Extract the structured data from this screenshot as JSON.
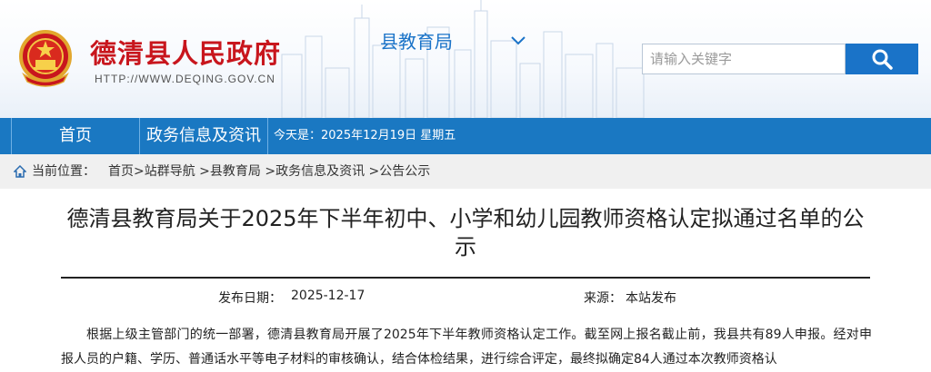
{
  "header": {
    "site_title": "德清县人民政府",
    "site_url": "HTTP://WWW.DEQING.GOV.CN",
    "dept_selector": "县教育局",
    "search_placeholder": "请输入关键字",
    "brand_red": "#c8161d",
    "brand_blue": "#1a73c8"
  },
  "nav": {
    "items": [
      {
        "label": "首页"
      },
      {
        "label": "政务信息及资讯"
      }
    ],
    "date_text": "今天是：2025年12月19日 星期五",
    "bg_color": "#1a78c2"
  },
  "breadcrumb": {
    "prefix": "当前位置：",
    "items": [
      {
        "label": "首页"
      },
      {
        "label": ">站群导航"
      },
      {
        "label": " >县教育局"
      },
      {
        "label": " >政务信息及资讯"
      },
      {
        "label": " >公告公示"
      }
    ]
  },
  "article": {
    "title": "德清县教育局关于2025年下半年初中、小学和幼儿园教师资格认定拟通过名单的公示",
    "date_label": "发布日期：",
    "date": "2025-12-17",
    "source_label": "来源：",
    "source": "本站发布",
    "body": "根据上级主管部门的统一部署，德清县教育局开展了2025年下半年教师资格认定工作。截至网上报名截止前，我县共有89人申报。经对申报人员的户籍、学历、普通话水平等电子材料的审核确认，结合体检结果，进行综合评定，最终拟确定84人通过本次教师资格认"
  }
}
